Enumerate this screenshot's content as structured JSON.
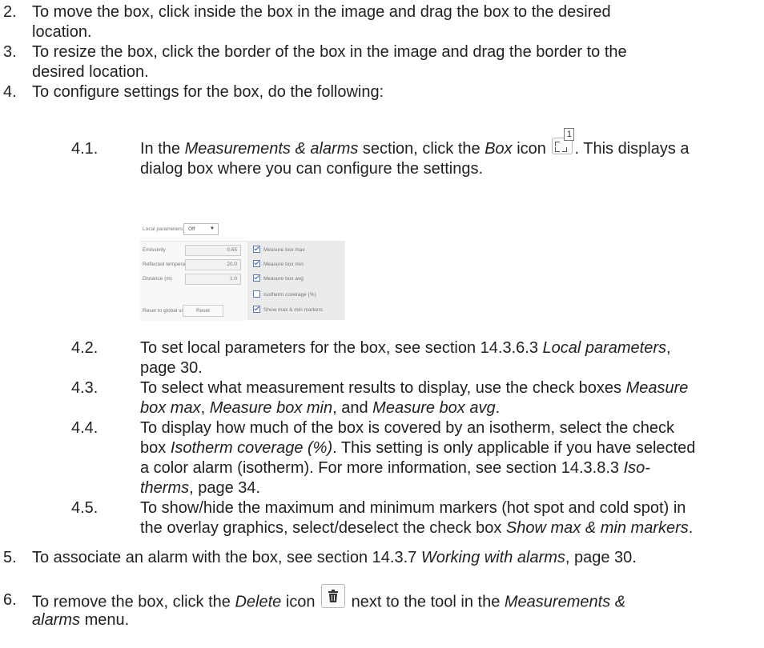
{
  "steps": [
    {
      "num": "2.",
      "lines": [
        "To move the box, click inside the box in the image and drag the box to the desired",
        "location."
      ]
    },
    {
      "num": "3.",
      "lines": [
        "To resize the box, click the border of the box in the image and drag the border to the",
        "desired location."
      ]
    },
    {
      "num": "4.",
      "lines": [
        "To configure settings for the box, do the following:"
      ]
    }
  ],
  "sub41": {
    "num": "4.1.",
    "line1_a": "In the ",
    "line1_b": "Measurements & alarms",
    "line1_c": " section, click the ",
    "line1_d": "Box",
    "line1_e": " icon",
    "line1_f": ". This displays a",
    "line2": "dialog box where you can configure the settings.",
    "box_icon_badge": "1"
  },
  "dialog": {
    "local_parameters_label": "Local parameters:",
    "local_parameters_value": "Off",
    "emissivity_label": "Emissivity",
    "emissivity_value": "0.65",
    "reflected_label": "Reflected temperature (°C)",
    "reflected_value": "20.0",
    "distance_label": "Distance (m)",
    "distance_value": "1.0",
    "reset_label": "Reset to global values",
    "reset_button": "Reset",
    "checks": [
      {
        "label": "Measure box max",
        "checked": true
      },
      {
        "label": "Measure box min",
        "checked": true
      },
      {
        "label": "Measure box avg",
        "checked": true
      },
      {
        "label": "Isotherm coverage (%)",
        "checked": false
      },
      {
        "label": "Show max & min markers",
        "checked": true
      }
    ]
  },
  "sub42": {
    "num": "4.2.",
    "a": "To set local parameters for the box, see section 14.3.6.3 ",
    "b": "Local parameters",
    "c": ",",
    "line2": "page 30."
  },
  "sub43": {
    "num": "4.3.",
    "a": "To select what measurement results to display, use the check boxes ",
    "b": "Measure",
    "c": "box max",
    "d": ", ",
    "e": "Measure box min",
    "f": ", and ",
    "g": "Measure box avg",
    "h": "."
  },
  "sub44": {
    "num": "4.4.",
    "a": "To display how much of the box is covered by an isotherm, select the check",
    "b": "box ",
    "c": "Isotherm coverage (%)",
    "d": ". This setting is only applicable if you have selected",
    "e": "a color alarm (isotherm). For more information, see section 14.3.8.3 ",
    "f": "Iso-",
    "g": "therms",
    "h": ", page 34."
  },
  "sub45": {
    "num": "4.5.",
    "a": "To show/hide the maximum and minimum markers (hot spot and cold spot) in",
    "b": "the overlay graphics, select/deselect the check box ",
    "c": "Show max & min markers",
    "d": "."
  },
  "step5": {
    "num": "5.",
    "a": "To associate an alarm with the box, see section 14.3.7 ",
    "b": "Working with alarms",
    "c": ", page 30."
  },
  "step6": {
    "num": "6.",
    "a": "To remove the box, click the ",
    "b": "Delete",
    "c": " icon",
    "d": " next to the tool in the ",
    "e": "Measurements &",
    "f": "alarms",
    "g": " menu."
  }
}
